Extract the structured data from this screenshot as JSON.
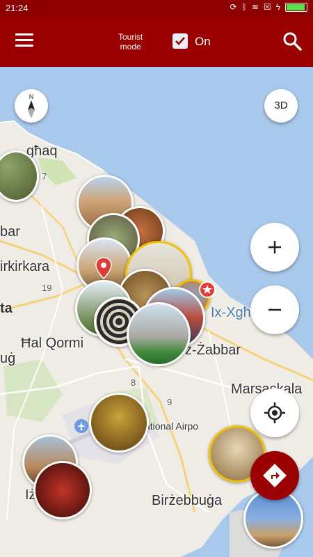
{
  "statusbar": {
    "time": "21:24",
    "battery_level": 0.85
  },
  "appbar": {
    "tourist_mode_label_line1": "Tourist",
    "tourist_mode_label_line2": "mode",
    "tourist_mode_checked": true,
    "tourist_mode_state": "On"
  },
  "map": {
    "labels": {
      "gharghur": "għaq",
      "birkirkara_partial": "bar",
      "birkirkara": "irkirkara",
      "valletta_partial": "ta",
      "hal_qormi": "Ħal Qormi",
      "luq_partial": "uġ",
      "xghajra": "Ix-Xgħ",
      "zabbar": "z-Żabbar",
      "marsaskala": "Marsaskala",
      "airport": "ational Airpo",
      "birzebbuga": "Birżebbuġa",
      "iz_partial": "Iż",
      "road_19": "19",
      "road_8": "8",
      "road_9": "9",
      "road_7": "7"
    },
    "three_d_label": "3D"
  },
  "colors": {
    "appbar": "#9b0000",
    "statusbar": "#8e0000",
    "water": "#a8c8ec",
    "land": "#eeece4",
    "pin": "#e53935",
    "gold_ring": "#f2c200"
  },
  "icons": [
    "menu-icon",
    "checkbox-icon",
    "search-icon",
    "compass-icon",
    "plus-icon",
    "minus-icon",
    "my-location-icon",
    "directions-icon",
    "map-pin-icon",
    "airport-icon",
    "star-marker-icon"
  ]
}
